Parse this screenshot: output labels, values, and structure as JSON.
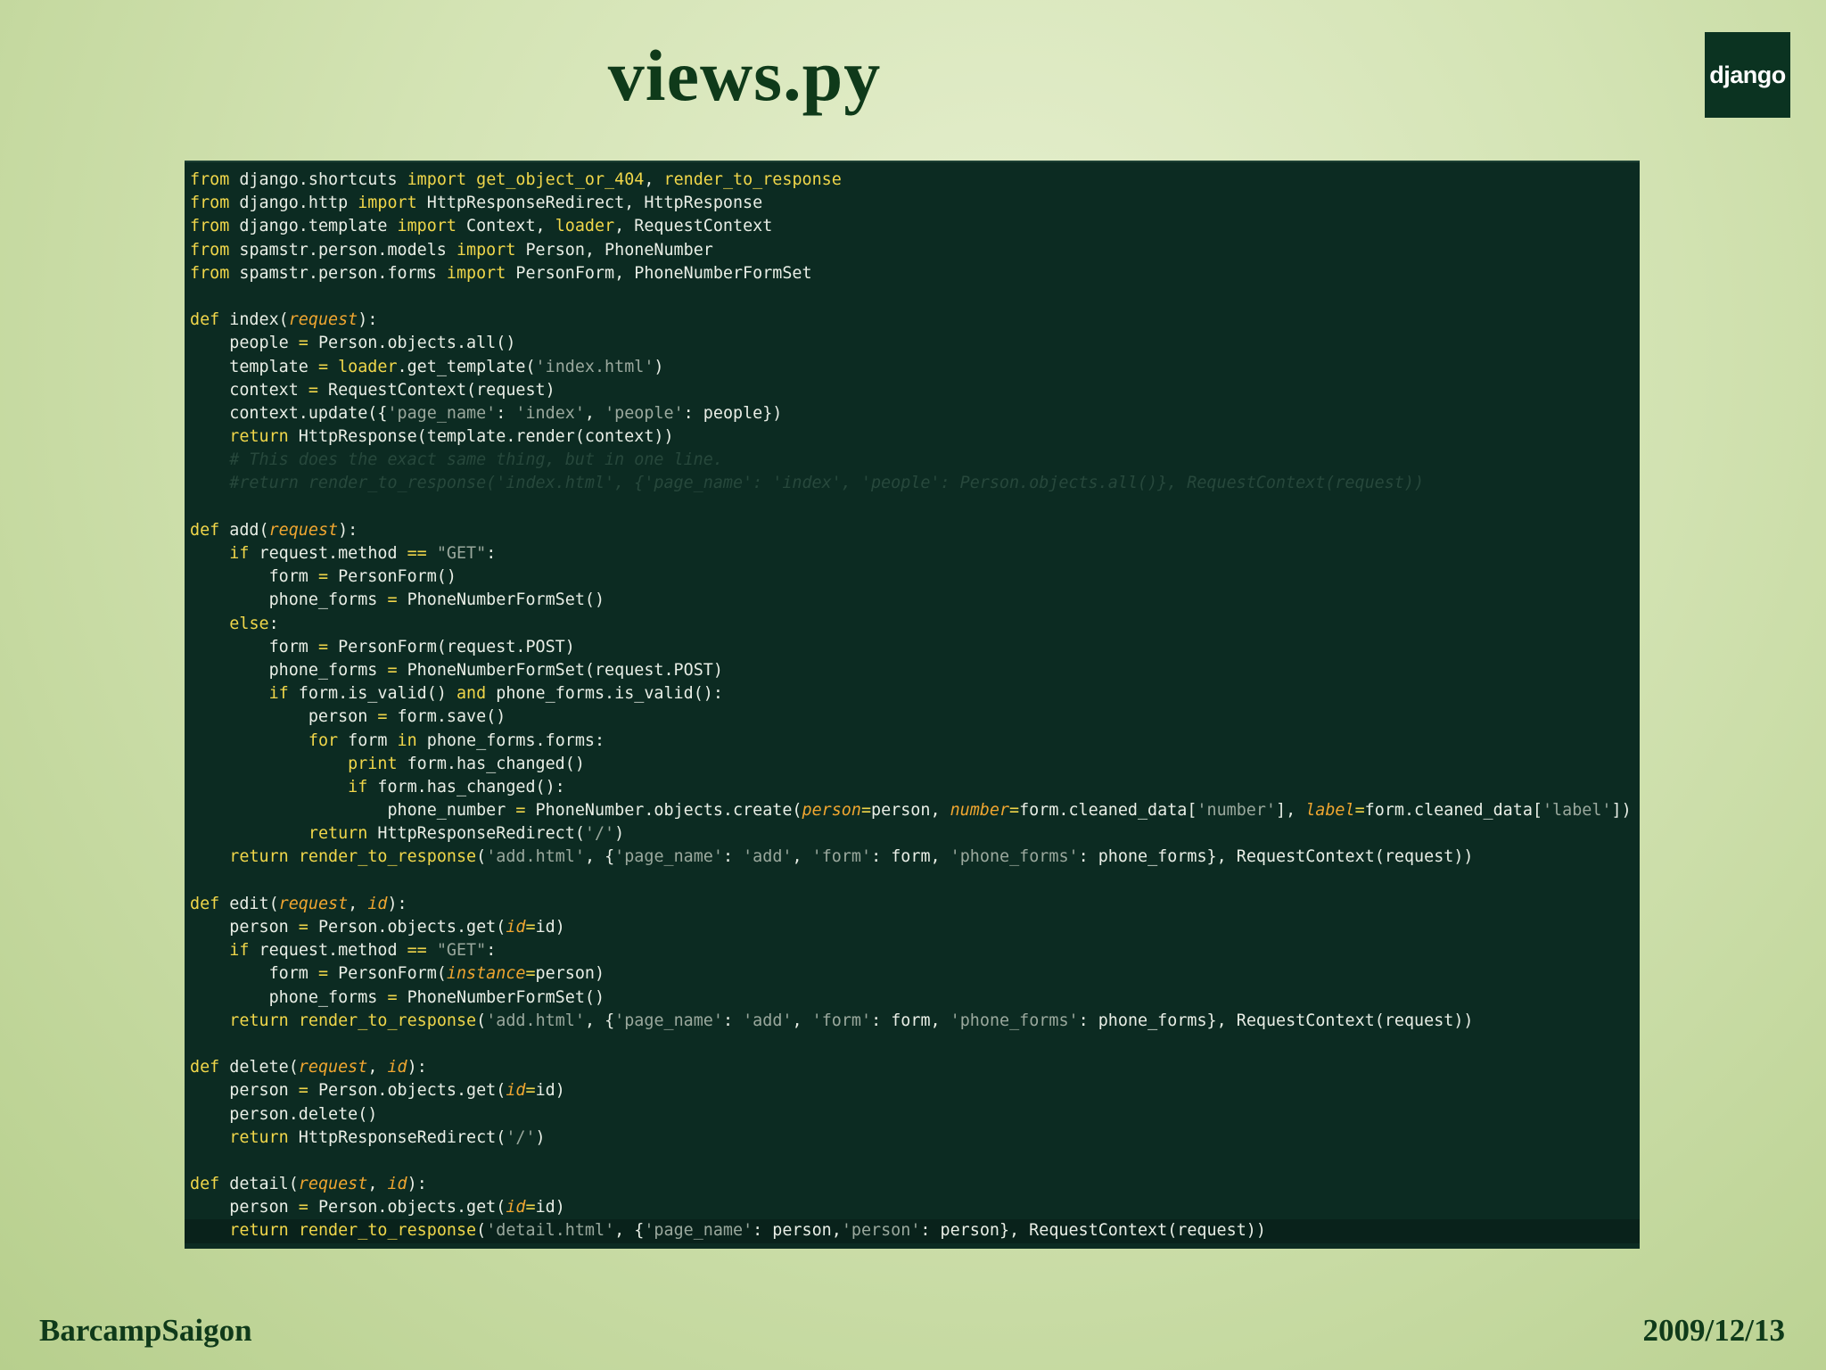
{
  "slide": {
    "title": "views.py",
    "logo_text": "django",
    "footer_left": "BarcampSaigon",
    "footer_right": "2009/12/13"
  },
  "colors": {
    "background_light": "#e6efcf",
    "background_dark": "#b7cf8d",
    "code_background": "#0c2b22",
    "keyword": "#f0d64a",
    "string": "#9aa89d",
    "parameter": "#f0a630",
    "comment": "#27483c",
    "title": "#0f3a1a"
  },
  "code": {
    "lines": [
      [
        [
          "k",
          "from"
        ],
        [
          "t",
          " django.shortcuts "
        ],
        [
          "k",
          "import"
        ],
        [
          "t",
          " "
        ],
        [
          "n",
          "get_object_or_404"
        ],
        [
          "t",
          ", "
        ],
        [
          "n",
          "render_to_response"
        ]
      ],
      [
        [
          "k",
          "from"
        ],
        [
          "t",
          " django.http "
        ],
        [
          "k",
          "import"
        ],
        [
          "t",
          " HttpResponseRedirect, HttpResponse"
        ]
      ],
      [
        [
          "k",
          "from"
        ],
        [
          "t",
          " django.template "
        ],
        [
          "k",
          "import"
        ],
        [
          "t",
          " Context, "
        ],
        [
          "n",
          "loader"
        ],
        [
          "t",
          ", RequestContext"
        ]
      ],
      [
        [
          "k",
          "from"
        ],
        [
          "t",
          " spamstr.person.models "
        ],
        [
          "k",
          "import"
        ],
        [
          "t",
          " Person, PhoneNumber"
        ]
      ],
      [
        [
          "k",
          "from"
        ],
        [
          "t",
          " spamstr.person.forms "
        ],
        [
          "k",
          "import"
        ],
        [
          "t",
          " PersonForm, PhoneNumberFormSet"
        ]
      ],
      [
        [
          "t",
          ""
        ]
      ],
      [
        [
          "k",
          "def"
        ],
        [
          "t",
          " index("
        ],
        [
          "p",
          "request"
        ],
        [
          "t",
          "):"
        ]
      ],
      [
        [
          "t",
          "    people "
        ],
        [
          "o",
          "="
        ],
        [
          "t",
          " Person.objects.all()"
        ]
      ],
      [
        [
          "t",
          "    template "
        ],
        [
          "o",
          "="
        ],
        [
          "t",
          " "
        ],
        [
          "n",
          "loader"
        ],
        [
          "t",
          ".get_template("
        ],
        [
          "s",
          "'index.html'"
        ],
        [
          "t",
          ")"
        ]
      ],
      [
        [
          "t",
          "    context "
        ],
        [
          "o",
          "="
        ],
        [
          "t",
          " RequestContext(request)"
        ]
      ],
      [
        [
          "t",
          "    context.update({"
        ],
        [
          "s",
          "'page_name'"
        ],
        [
          "t",
          ": "
        ],
        [
          "s",
          "'index'"
        ],
        [
          "t",
          ", "
        ],
        [
          "s",
          "'people'"
        ],
        [
          "t",
          ": people})"
        ]
      ],
      [
        [
          "t",
          "    "
        ],
        [
          "k",
          "return"
        ],
        [
          "t",
          " HttpResponse(template.render(context))"
        ]
      ],
      [
        [
          "c",
          "    # This does the exact same thing, but in one line."
        ]
      ],
      [
        [
          "c",
          "    #return render_to_response('index.html', {'page_name': 'index', 'people': Person.objects.all()}, RequestContext(request))"
        ]
      ],
      [
        [
          "t",
          ""
        ]
      ],
      [
        [
          "k",
          "def"
        ],
        [
          "t",
          " add("
        ],
        [
          "p",
          "request"
        ],
        [
          "t",
          "):"
        ]
      ],
      [
        [
          "t",
          "    "
        ],
        [
          "k",
          "if"
        ],
        [
          "t",
          " request.method "
        ],
        [
          "o",
          "=="
        ],
        [
          "t",
          " "
        ],
        [
          "s",
          "\"GET\""
        ],
        [
          "t",
          ":"
        ]
      ],
      [
        [
          "t",
          "        form "
        ],
        [
          "o",
          "="
        ],
        [
          "t",
          " PersonForm()"
        ]
      ],
      [
        [
          "t",
          "        phone_forms "
        ],
        [
          "o",
          "="
        ],
        [
          "t",
          " PhoneNumberFormSet()"
        ]
      ],
      [
        [
          "t",
          "    "
        ],
        [
          "k",
          "else"
        ],
        [
          "t",
          ":"
        ]
      ],
      [
        [
          "t",
          "        form "
        ],
        [
          "o",
          "="
        ],
        [
          "t",
          " PersonForm(request.POST)"
        ]
      ],
      [
        [
          "t",
          "        phone_forms "
        ],
        [
          "o",
          "="
        ],
        [
          "t",
          " PhoneNumberFormSet(request.POST)"
        ]
      ],
      [
        [
          "t",
          "        "
        ],
        [
          "k",
          "if"
        ],
        [
          "t",
          " form.is_valid() "
        ],
        [
          "k",
          "and"
        ],
        [
          "t",
          " phone_forms.is_valid():"
        ]
      ],
      [
        [
          "t",
          "            person "
        ],
        [
          "o",
          "="
        ],
        [
          "t",
          " form.save()"
        ]
      ],
      [
        [
          "t",
          "            "
        ],
        [
          "k",
          "for"
        ],
        [
          "t",
          " form "
        ],
        [
          "k",
          "in"
        ],
        [
          "t",
          " phone_forms.forms:"
        ]
      ],
      [
        [
          "t",
          "                "
        ],
        [
          "k",
          "print"
        ],
        [
          "t",
          " form.has_changed()"
        ]
      ],
      [
        [
          "t",
          "                "
        ],
        [
          "k",
          "if"
        ],
        [
          "t",
          " form.has_changed():"
        ]
      ],
      [
        [
          "t",
          "                    phone_number "
        ],
        [
          "o",
          "="
        ],
        [
          "t",
          " PhoneNumber.objects.create("
        ],
        [
          "p",
          "person"
        ],
        [
          "o",
          "="
        ],
        [
          "t",
          "person, "
        ],
        [
          "p",
          "number"
        ],
        [
          "o",
          "="
        ],
        [
          "t",
          "form.cleaned_data["
        ],
        [
          "s",
          "'number'"
        ],
        [
          "t",
          "], "
        ],
        [
          "p",
          "label"
        ],
        [
          "o",
          "="
        ],
        [
          "t",
          "form.cleaned_data["
        ],
        [
          "s",
          "'label'"
        ],
        [
          "t",
          "])"
        ]
      ],
      [
        [
          "t",
          "            "
        ],
        [
          "k",
          "return"
        ],
        [
          "t",
          " HttpResponseRedirect("
        ],
        [
          "s",
          "'/'"
        ],
        [
          "t",
          ")"
        ]
      ],
      [
        [
          "t",
          "    "
        ],
        [
          "k",
          "return"
        ],
        [
          "t",
          " "
        ],
        [
          "n",
          "render_to_response"
        ],
        [
          "t",
          "("
        ],
        [
          "s",
          "'add.html'"
        ],
        [
          "t",
          ", {"
        ],
        [
          "s",
          "'page_name'"
        ],
        [
          "t",
          ": "
        ],
        [
          "s",
          "'add'"
        ],
        [
          "t",
          ", "
        ],
        [
          "s",
          "'form'"
        ],
        [
          "t",
          ": form, "
        ],
        [
          "s",
          "'phone_forms'"
        ],
        [
          "t",
          ": phone_forms}, RequestContext(request))"
        ]
      ],
      [
        [
          "t",
          ""
        ]
      ],
      [
        [
          "k",
          "def"
        ],
        [
          "t",
          " edit("
        ],
        [
          "p",
          "request"
        ],
        [
          "t",
          ", "
        ],
        [
          "p",
          "id"
        ],
        [
          "t",
          "):"
        ]
      ],
      [
        [
          "t",
          "    person "
        ],
        [
          "o",
          "="
        ],
        [
          "t",
          " Person.objects.get("
        ],
        [
          "p",
          "id"
        ],
        [
          "o",
          "="
        ],
        [
          "t",
          "id)"
        ]
      ],
      [
        [
          "t",
          "    "
        ],
        [
          "k",
          "if"
        ],
        [
          "t",
          " request.method "
        ],
        [
          "o",
          "=="
        ],
        [
          "t",
          " "
        ],
        [
          "s",
          "\"GET\""
        ],
        [
          "t",
          ":"
        ]
      ],
      [
        [
          "t",
          "        form "
        ],
        [
          "o",
          "="
        ],
        [
          "t",
          " PersonForm("
        ],
        [
          "p",
          "instance"
        ],
        [
          "o",
          "="
        ],
        [
          "t",
          "person)"
        ]
      ],
      [
        [
          "t",
          "        phone_forms "
        ],
        [
          "o",
          "="
        ],
        [
          "t",
          " PhoneNumberFormSet()"
        ]
      ],
      [
        [
          "t",
          "    "
        ],
        [
          "k",
          "return"
        ],
        [
          "t",
          " "
        ],
        [
          "n",
          "render_to_response"
        ],
        [
          "t",
          "("
        ],
        [
          "s",
          "'add.html'"
        ],
        [
          "t",
          ", {"
        ],
        [
          "s",
          "'page_name'"
        ],
        [
          "t",
          ": "
        ],
        [
          "s",
          "'add'"
        ],
        [
          "t",
          ", "
        ],
        [
          "s",
          "'form'"
        ],
        [
          "t",
          ": form, "
        ],
        [
          "s",
          "'phone_forms'"
        ],
        [
          "t",
          ": phone_forms}, RequestContext(request))"
        ]
      ],
      [
        [
          "t",
          ""
        ]
      ],
      [
        [
          "k",
          "def"
        ],
        [
          "t",
          " delete("
        ],
        [
          "p",
          "request"
        ],
        [
          "t",
          ", "
        ],
        [
          "p",
          "id"
        ],
        [
          "t",
          "):"
        ]
      ],
      [
        [
          "t",
          "    person "
        ],
        [
          "o",
          "="
        ],
        [
          "t",
          " Person.objects.get("
        ],
        [
          "p",
          "id"
        ],
        [
          "o",
          "="
        ],
        [
          "t",
          "id)"
        ]
      ],
      [
        [
          "t",
          "    person.delete()"
        ]
      ],
      [
        [
          "t",
          "    "
        ],
        [
          "k",
          "return"
        ],
        [
          "t",
          " HttpResponseRedirect("
        ],
        [
          "s",
          "'/'"
        ],
        [
          "t",
          ")"
        ]
      ],
      [
        [
          "t",
          ""
        ]
      ],
      [
        [
          "k",
          "def"
        ],
        [
          "t",
          " detail("
        ],
        [
          "p",
          "request"
        ],
        [
          "t",
          ", "
        ],
        [
          "p",
          "id"
        ],
        [
          "t",
          "):"
        ]
      ],
      [
        [
          "t",
          "    person "
        ],
        [
          "o",
          "="
        ],
        [
          "t",
          " Person.objects.get("
        ],
        [
          "p",
          "id"
        ],
        [
          "o",
          "="
        ],
        [
          "t",
          "id)"
        ]
      ],
      [
        [
          "t",
          "    "
        ],
        [
          "k",
          "return"
        ],
        [
          "t",
          " "
        ],
        [
          "n",
          "render_to_response"
        ],
        [
          "t",
          "("
        ],
        [
          "s",
          "'detail.html'"
        ],
        [
          "t",
          ", {"
        ],
        [
          "s",
          "'page_name'"
        ],
        [
          "t",
          ": person,"
        ],
        [
          "s",
          "'person'"
        ],
        [
          "t",
          ": person}, RequestContext(request))"
        ]
      ]
    ]
  }
}
